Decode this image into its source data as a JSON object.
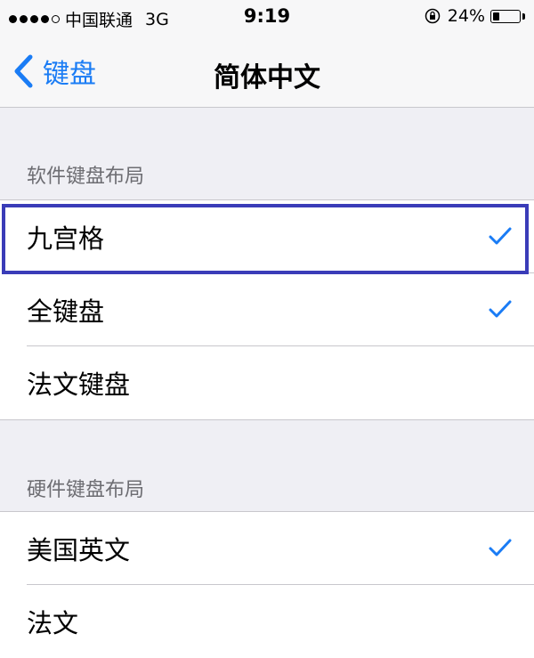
{
  "status_bar": {
    "signal_filled": 4,
    "signal_total": 5,
    "carrier": "中国联通",
    "network": "3G",
    "time": "9:19",
    "battery_text": "24%",
    "battery_level": 0.24
  },
  "nav": {
    "back_label": "键盘",
    "title": "简体中文"
  },
  "sections": {
    "software": {
      "header": "软件键盘布局",
      "items": [
        {
          "label": "九宫格",
          "checked": true
        },
        {
          "label": "全键盘",
          "checked": true
        },
        {
          "label": "法文键盘",
          "checked": false
        }
      ]
    },
    "hardware": {
      "header": "硬件键盘布局",
      "items": [
        {
          "label": "美国英文",
          "checked": true
        },
        {
          "label": "法文",
          "checked": false
        }
      ]
    }
  },
  "colors": {
    "accent": "#1a7cf5",
    "highlight_border": "#3a3cb8",
    "background": "#efeff4"
  }
}
